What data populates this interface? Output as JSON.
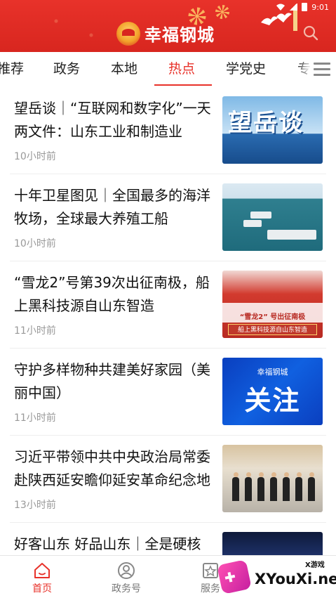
{
  "status": {
    "time": "9:01"
  },
  "header": {
    "app_name": "幸福钢城"
  },
  "tabs": [
    {
      "label": "推荐",
      "active": false
    },
    {
      "label": "政务",
      "active": false
    },
    {
      "label": "本地",
      "active": false
    },
    {
      "label": "热点",
      "active": true
    },
    {
      "label": "学党史",
      "active": false
    },
    {
      "label": "专",
      "active": false
    }
  ],
  "news": [
    {
      "title": "望岳谈｜“互联网和数字化”一天两文件：山东工业和制造业",
      "time": "10小时前",
      "thumb_text": "望岳谈"
    },
    {
      "title": "十年卫星图见｜全国最多的海洋牧场，全球最大养殖工船",
      "time": "10小时前"
    },
    {
      "title": "“雪龙2”号第39次出征南极，船上黑科技源自山东智造",
      "time": "11小时前",
      "thumb_caption_1": "“雪龙2” 号出征南极",
      "thumb_caption_2": "船上黑科技源自山东智造"
    },
    {
      "title": "守护多样物种共建美好家园（美丽中国）",
      "time": "11小时前",
      "thumb_small": "幸福钢城",
      "thumb_big": "关注"
    },
    {
      "title": "习近平带领中共中央政治局常委赴陕西延安瞻仰延安革命纪念地",
      "time": "13小时前"
    },
    {
      "title": "好客山东 好品山东｜全是硬核",
      "time": ""
    }
  ],
  "bottom_nav": [
    {
      "label": "首页",
      "active": true,
      "icon": "home-icon"
    },
    {
      "label": "政务号",
      "active": false,
      "icon": "profile-icon"
    },
    {
      "label": "服务",
      "active": false,
      "icon": "star-icon"
    }
  ],
  "watermark": {
    "brand": "XYouXi.net",
    "small": "X游戏"
  },
  "colors": {
    "brand_red": "#e8322a",
    "text": "#111111",
    "muted": "#999999"
  }
}
